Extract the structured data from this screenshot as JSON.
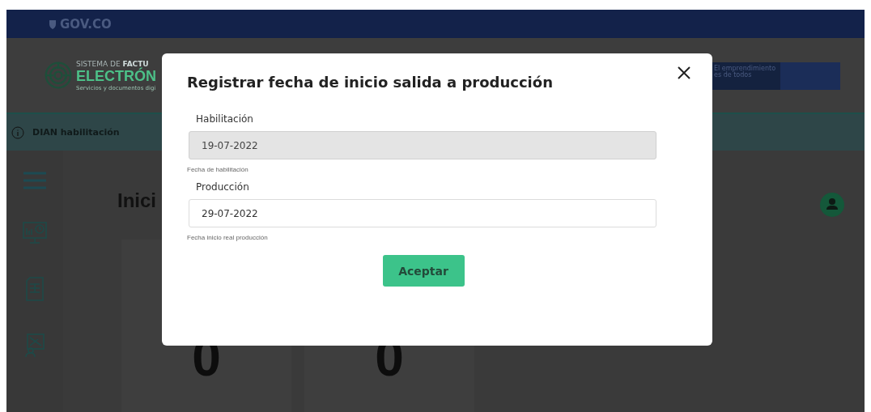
{
  "gov_bar": {
    "logo": "GOV.CO"
  },
  "header": {
    "system_line": "SISTEMA DE **FACTU**",
    "brand": "ELECTRÓN",
    "tagline": "Servicios y documentos digi",
    "banner": "El emprendimiento es de todos"
  },
  "notice_bar": {
    "text": "DIAN habilitación"
  },
  "page": {
    "title": "Inici",
    "counters": [
      "0",
      "0"
    ]
  },
  "modal": {
    "title": "Registrar fecha de inicio salida a producción",
    "fields": [
      {
        "label": "Habilitación",
        "value": "19-07-2022",
        "help": "Fecha de habilitación",
        "disabled": true
      },
      {
        "label": "Producción",
        "value": "29-07-2022",
        "help": "Fecha inicio real producción",
        "disabled": false
      }
    ],
    "button": "Aceptar"
  }
}
